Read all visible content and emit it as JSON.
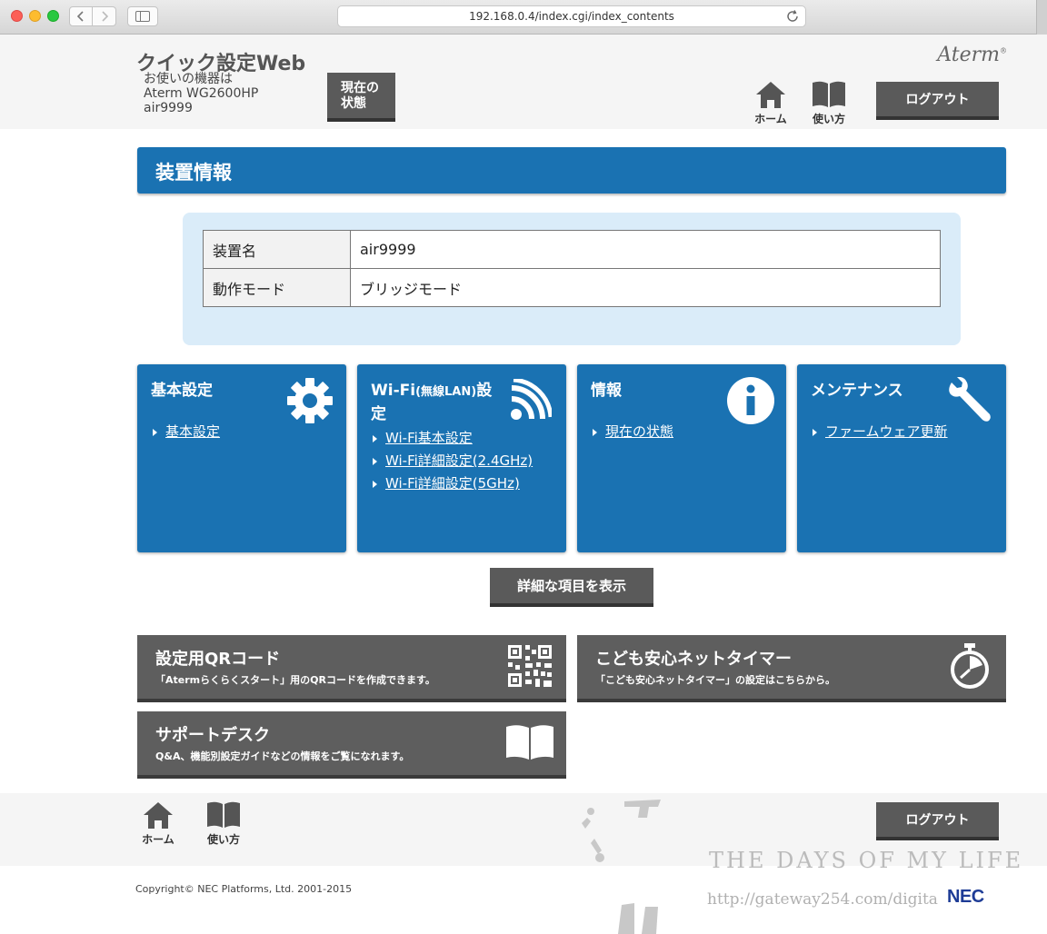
{
  "browser": {
    "url": "192.168.0.4/index.cgi/index_contents"
  },
  "header": {
    "site_title": "クイック設定Web",
    "device_label": "お使いの機器は",
    "device_model": "Aterm WG2600HP",
    "device_name": "air9999",
    "status_button": [
      "現在の",
      "状態"
    ],
    "brand": "Aterm",
    "home_label": "ホーム",
    "guide_label": "使い方",
    "logout_label": "ログアウト"
  },
  "section": {
    "title": "装置情報"
  },
  "device_info": {
    "rows": [
      {
        "key": "装置名",
        "value": "air9999"
      },
      {
        "key": "動作モード",
        "value": "ブリッジモード"
      }
    ]
  },
  "tiles": [
    {
      "title": "基本設定",
      "icon": "gear-icon",
      "links": [
        "基本設定"
      ]
    },
    {
      "title_main": "Wi-Fi",
      "title_small": "(無線LAN)",
      "title_rest": "設",
      "title_line2": "定",
      "icon": "wifi-icon",
      "links": [
        "Wi-Fi基本設定",
        "Wi-Fi詳細設定(2.4GHz)",
        "Wi-Fi詳細設定(5GHz)"
      ]
    },
    {
      "title": "情報",
      "icon": "info-icon",
      "links": [
        "現在の状態"
      ]
    },
    {
      "title": "メンテナンス",
      "icon": "wrench-icon",
      "links": [
        "ファームウェア更新"
      ]
    }
  ],
  "detail_button": "詳細な項目を表示",
  "feature_tiles": [
    {
      "title": "設定用QRコード",
      "desc": "「Atermらくらくスタート」用のQRコードを作成できます。",
      "icon": "qr-code-icon"
    },
    {
      "title": "こども安心ネットタイマー",
      "desc": "「こども安心ネットタイマー」の設定はこちらから。",
      "icon": "stopwatch-icon"
    },
    {
      "title": "サポートデスク",
      "desc": "Q&A、機能別設定ガイドなどの情報をご覧になれます。",
      "icon": "book-icon"
    }
  ],
  "footer": {
    "home_label": "ホーム",
    "guide_label": "使い方",
    "logout_label": "ログアウト",
    "copyright": "Copyright© NEC Platforms, Ltd. 2001-2015",
    "nec_logo": "NEC"
  },
  "watermark": {
    "title": "THE DAYS OF MY LIFE",
    "url": "http://gateway254.com/digita"
  },
  "colors": {
    "primary_blue": "#1a72b2",
    "dark_button": "#5a5a5a",
    "panel_bg": "#daecf9"
  }
}
